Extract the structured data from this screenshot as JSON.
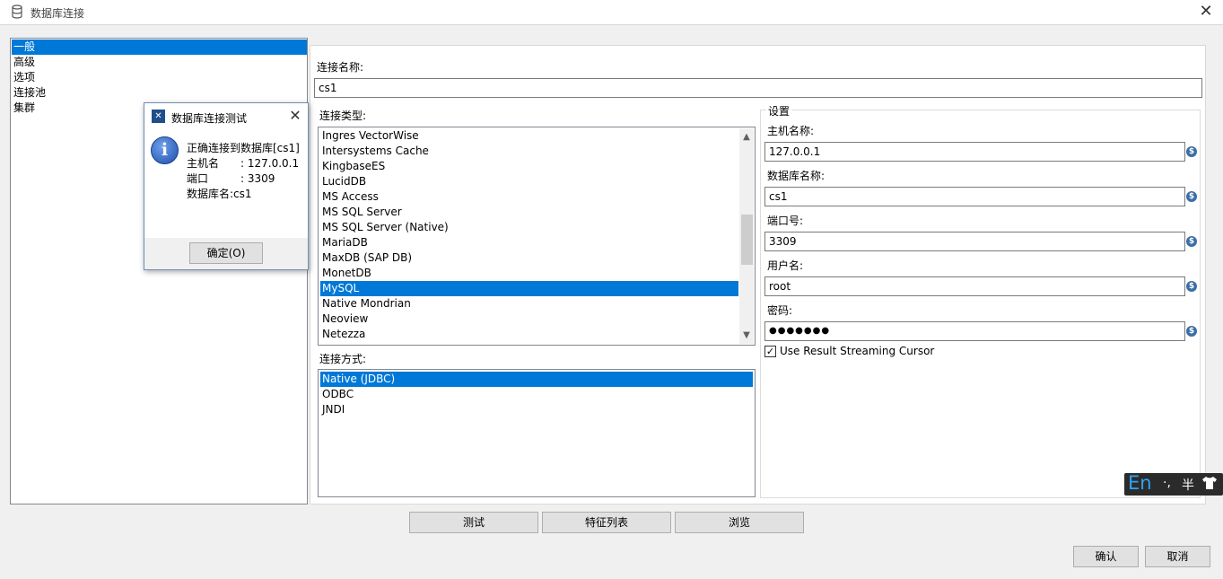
{
  "window": {
    "title": "数据库连接",
    "icon": "database-icon",
    "close": "✕"
  },
  "nav": {
    "items": [
      "一般",
      "高级",
      "选项",
      "连接池",
      "集群"
    ],
    "selected_index": 0
  },
  "connection_name": {
    "label": "连接名称:",
    "value": "cs1"
  },
  "connection_type": {
    "label": "连接类型:",
    "items": [
      "Ingres VectorWise",
      "Intersystems Cache",
      "KingbaseES",
      "LucidDB",
      "MS Access",
      "MS SQL Server",
      "MS SQL Server (Native)",
      "MariaDB",
      "MaxDB (SAP DB)",
      "MonetDB",
      "MySQL",
      "Native Mondrian",
      "Neoview",
      "Netezza"
    ],
    "selected": "MySQL"
  },
  "access_method": {
    "label": "连接方式:",
    "items": [
      "Native (JDBC)",
      "ODBC",
      "JNDI"
    ],
    "selected": "Native (JDBC)"
  },
  "settings": {
    "legend": "设置",
    "fields": [
      {
        "label": "主机名称:",
        "value": "127.0.0.1"
      },
      {
        "label": "数据库名称:",
        "value": "cs1"
      },
      {
        "label": "端口号:",
        "value": "3309"
      },
      {
        "label": "用户名:",
        "value": "root"
      },
      {
        "label": "密码:",
        "value": "●●●●●●●"
      }
    ],
    "variable_icon": "$",
    "streaming_cursor": {
      "label": "Use Result Streaming Cursor",
      "checked": true
    }
  },
  "buttons": {
    "test": "测试",
    "features": "特征列表",
    "browse": "浏览",
    "ok": "确认",
    "cancel": "取消"
  },
  "dialog": {
    "title": "数据库连接测试",
    "close": "✕",
    "lines": [
      "正确连接到数据库[cs1]",
      "主机名　　: 127.0.0.1",
      "端口　　　: 3309",
      "数据库名:cs1"
    ],
    "ok": "确定(O)"
  },
  "ime": {
    "mode": "En",
    "punct": "·,",
    "width": "半"
  },
  "colors": {
    "selection": "#0078d7",
    "dialog_border": "#6e8fb5"
  }
}
